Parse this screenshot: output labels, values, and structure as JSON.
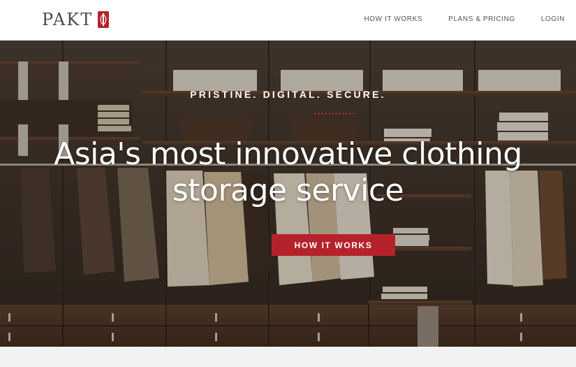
{
  "brand": {
    "name": "PAKT",
    "accent": "#b5222b"
  },
  "nav": {
    "items": [
      {
        "label": "HOW IT WORKS"
      },
      {
        "label": "PLANS & PRICING"
      },
      {
        "label": "LOGIN"
      }
    ]
  },
  "hero": {
    "tagline": "PRISTINE. DIGITAL. SECURE.",
    "headline_line1": "Asia's most innovative clothing",
    "headline_line2": "storage service",
    "cta_label": "HOW IT WORKS",
    "image": "wardrobe-closet-photo"
  }
}
